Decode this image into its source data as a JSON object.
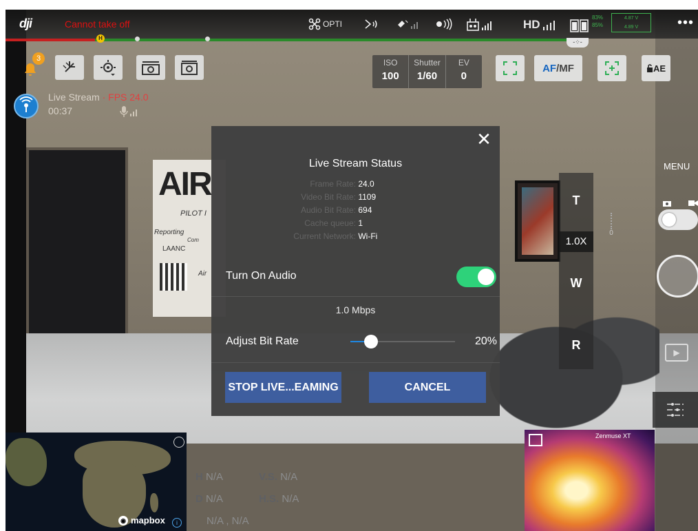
{
  "topbar": {
    "status": "Cannot take off",
    "aircraft_mode": "OPTI",
    "hd_label": "HD",
    "battery_box": [
      "4.87 V",
      "4.89 V"
    ],
    "battery_pct": [
      "83%",
      "85%"
    ],
    "more": "•••"
  },
  "notifications": {
    "count": "3"
  },
  "exposure": {
    "iso_label": "ISO",
    "iso_value": "100",
    "shutter_label": "Shutter",
    "shutter_value": "1/60",
    "ev_label": "EV",
    "ev_value": "0"
  },
  "camera_controls": {
    "af_label": "AF",
    "mf_label": "/MF",
    "ae_label": "AE"
  },
  "live_stream": {
    "label": "Live Stream",
    "fps": "· FPS 24.0",
    "time": "00:37"
  },
  "right_panel": {
    "menu": "MENU",
    "ev_value": "0"
  },
  "zoom": {
    "tele": "T",
    "level": "1.0X",
    "wide": "W",
    "reset": "R"
  },
  "dialog": {
    "title": "Live Stream Status",
    "stats": [
      {
        "key": "Frame Rate:",
        "value": "24.0"
      },
      {
        "key": "Video Bit Rate:",
        "value": "1109"
      },
      {
        "key": "Audio Bit Rate:",
        "value": "694"
      },
      {
        "key": "Cache queue:",
        "value": "1"
      },
      {
        "key": "Current Network:",
        "value": "Wi-Fi"
      }
    ],
    "audio_label": "Turn On Audio",
    "audio_on": true,
    "bitrate_value": "1.0 Mbps",
    "bitrate_label": "Adjust Bit Rate",
    "bitrate_percent": "20%",
    "bitrate_fraction": 0.2,
    "stop_button": "STOP LIVE...EAMING",
    "cancel_button": "CANCEL"
  },
  "map": {
    "attribution": "mapbox"
  },
  "telemetry": {
    "h_label": "H",
    "h_value": "N/A",
    "vs_label": "V.S.",
    "vs_value": "N/A",
    "d_label": "D",
    "d_value": "N/A",
    "hs_label": "H.S.",
    "hs_value": "N/A",
    "coords": "N/A , N/A"
  },
  "thermal": {
    "label": "Zenmuse XT"
  },
  "scene_text": {
    "banner_big": "AIR",
    "banner_pilot": "PILOT I",
    "banner_reporting": "Reporting",
    "banner_com": "Com",
    "banner_laanc": "LAANC",
    "banner_air": "Air"
  },
  "colors": {
    "accent": "#3e5e9f",
    "toggle_on": "#2ed27a",
    "warning": "#d11111",
    "live": "#1d7fd0"
  }
}
